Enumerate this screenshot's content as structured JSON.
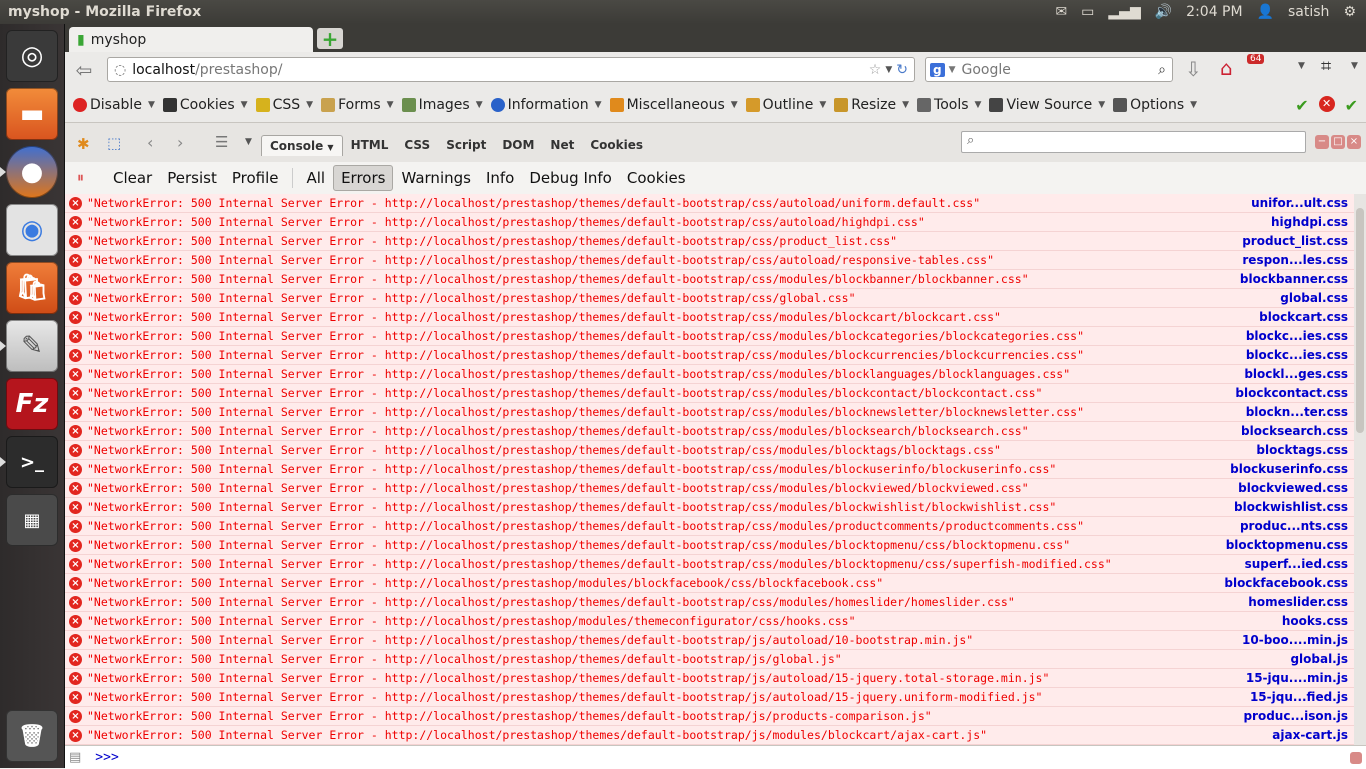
{
  "system": {
    "window_title": "myshop - Mozilla Firefox",
    "clock": "2:04 PM",
    "user": "satish"
  },
  "browser": {
    "tab_title": "myshop",
    "url_host": "localhost",
    "url_path": "/prestashop/",
    "search_placeholder": "Google",
    "download_badge": "64"
  },
  "webdev": {
    "items": [
      "Disable",
      "Cookies",
      "CSS",
      "Forms",
      "Images",
      "Information",
      "Miscellaneous",
      "Outline",
      "Resize",
      "Tools",
      "View Source",
      "Options"
    ]
  },
  "firebug": {
    "tabs": [
      "Console",
      "HTML",
      "CSS",
      "Script",
      "DOM",
      "Net",
      "Cookies"
    ],
    "filters": [
      "Clear",
      "Persist",
      "Profile",
      "All",
      "Errors",
      "Warnings",
      "Info",
      "Debug Info",
      "Cookies"
    ],
    "active_filter": "Errors",
    "prompt": ">>>"
  },
  "log": {
    "prefix": "\"NetworkError: 500 Internal Server Error - ",
    "rows": [
      {
        "url": "http://localhost/prestashop/themes/default-bootstrap/css/autoload/uniform.default.css\"",
        "src": "unifor...ult.css"
      },
      {
        "url": "http://localhost/prestashop/themes/default-bootstrap/css/autoload/highdpi.css\"",
        "src": "highdpi.css"
      },
      {
        "url": "http://localhost/prestashop/themes/default-bootstrap/css/product_list.css\"",
        "src": "product_list.css"
      },
      {
        "url": "http://localhost/prestashop/themes/default-bootstrap/css/autoload/responsive-tables.css\"",
        "src": "respon...les.css"
      },
      {
        "url": "http://localhost/prestashop/themes/default-bootstrap/css/modules/blockbanner/blockbanner.css\"",
        "src": "blockbanner.css"
      },
      {
        "url": "http://localhost/prestashop/themes/default-bootstrap/css/global.css\"",
        "src": "global.css"
      },
      {
        "url": "http://localhost/prestashop/themes/default-bootstrap/css/modules/blockcart/blockcart.css\"",
        "src": "blockcart.css"
      },
      {
        "url": "http://localhost/prestashop/themes/default-bootstrap/css/modules/blockcategories/blockcategories.css\"",
        "src": "blockc...ies.css"
      },
      {
        "url": "http://localhost/prestashop/themes/default-bootstrap/css/modules/blockcurrencies/blockcurrencies.css\"",
        "src": "blockc...ies.css"
      },
      {
        "url": "http://localhost/prestashop/themes/default-bootstrap/css/modules/blocklanguages/blocklanguages.css\"",
        "src": "blockl...ges.css"
      },
      {
        "url": "http://localhost/prestashop/themes/default-bootstrap/css/modules/blockcontact/blockcontact.css\"",
        "src": "blockcontact.css"
      },
      {
        "url": "http://localhost/prestashop/themes/default-bootstrap/css/modules/blocknewsletter/blocknewsletter.css\"",
        "src": "blockn...ter.css"
      },
      {
        "url": "http://localhost/prestashop/themes/default-bootstrap/css/modules/blocksearch/blocksearch.css\"",
        "src": "blocksearch.css"
      },
      {
        "url": "http://localhost/prestashop/themes/default-bootstrap/css/modules/blocktags/blocktags.css\"",
        "src": "blocktags.css"
      },
      {
        "url": "http://localhost/prestashop/themes/default-bootstrap/css/modules/blockuserinfo/blockuserinfo.css\"",
        "src": "blockuserinfo.css"
      },
      {
        "url": "http://localhost/prestashop/themes/default-bootstrap/css/modules/blockviewed/blockviewed.css\"",
        "src": "blockviewed.css"
      },
      {
        "url": "http://localhost/prestashop/themes/default-bootstrap/css/modules/blockwishlist/blockwishlist.css\"",
        "src": "blockwishlist.css"
      },
      {
        "url": "http://localhost/prestashop/themes/default-bootstrap/css/modules/productcomments/productcomments.css\"",
        "src": "produc...nts.css"
      },
      {
        "url": "http://localhost/prestashop/themes/default-bootstrap/css/modules/blocktopmenu/css/blocktopmenu.css\"",
        "src": "blocktopmenu.css"
      },
      {
        "url": "http://localhost/prestashop/themes/default-bootstrap/css/modules/blocktopmenu/css/superfish-modified.css\"",
        "src": "superf...ied.css"
      },
      {
        "url": "http://localhost/prestashop/modules/blockfacebook/css/blockfacebook.css\"",
        "src": "blockfacebook.css"
      },
      {
        "url": "http://localhost/prestashop/themes/default-bootstrap/css/modules/homeslider/homeslider.css\"",
        "src": "homeslider.css"
      },
      {
        "url": "http://localhost/prestashop/modules/themeconfigurator/css/hooks.css\"",
        "src": "hooks.css"
      },
      {
        "url": "http://localhost/prestashop/themes/default-bootstrap/js/autoload/10-bootstrap.min.js\"",
        "src": "10-boo....min.js"
      },
      {
        "url": "http://localhost/prestashop/themes/default-bootstrap/js/global.js\"",
        "src": "global.js"
      },
      {
        "url": "http://localhost/prestashop/themes/default-bootstrap/js/autoload/15-jquery.total-storage.min.js\"",
        "src": "15-jqu....min.js"
      },
      {
        "url": "http://localhost/prestashop/themes/default-bootstrap/js/autoload/15-jquery.uniform-modified.js\"",
        "src": "15-jqu...fied.js"
      },
      {
        "url": "http://localhost/prestashop/themes/default-bootstrap/js/products-comparison.js\"",
        "src": "produc...ison.js"
      },
      {
        "url": "http://localhost/prestashop/themes/default-bootstrap/js/modules/blockcart/ajax-cart.js\"",
        "src": "ajax-cart.js"
      }
    ]
  },
  "colors": {
    "error_bg": "#ffebeb",
    "error_text": "#e00000",
    "source_link": "#0000cc",
    "launcher": "#2e2b2b"
  }
}
